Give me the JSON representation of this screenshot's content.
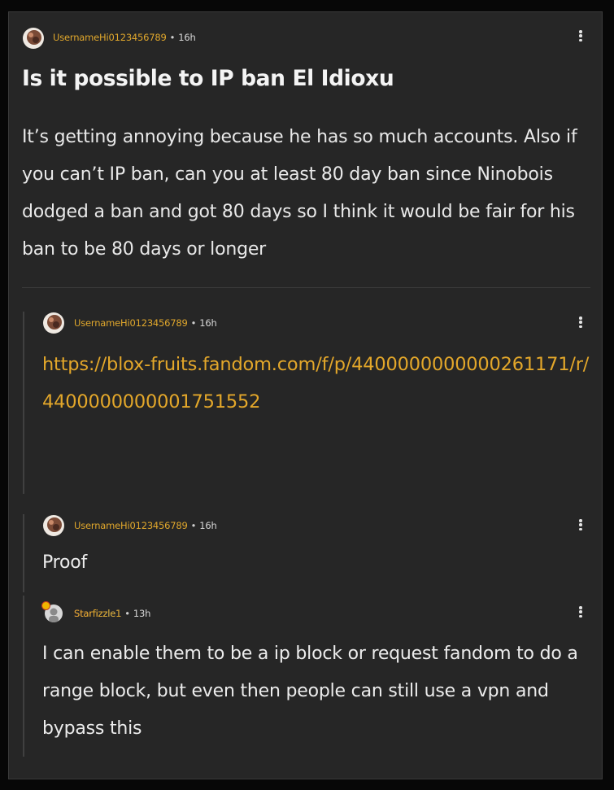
{
  "post": {
    "author": "UsernameHi0123456789",
    "time": "16h",
    "title": "Is it possible to IP ban El Idioxu",
    "body": "It’s getting annoying because he has so much accounts. Also if you can’t IP ban, can you at least 80 day ban since Ninobois dodged a ban and got 80 days so I think it would be fair for his ban to be 80 days or longer"
  },
  "replies": [
    {
      "author": "UsernameHi0123456789",
      "time": "16h",
      "text": "https://blox-fruits.fandom.com/f/p/4400000000000261171/r/4400000000001751552"
    },
    {
      "author": "UsernameHi0123456789",
      "time": "16h",
      "text": "Proof"
    },
    {
      "author": "Starfizzle1",
      "time": "13h",
      "text": "I can enable them to be a ip block or request fandom to do a range block, but even then people can still use a vpn and bypass this"
    }
  ],
  "separator": "•",
  "icons": {
    "more": "more-vertical-icon",
    "avatar": "user-avatar",
    "badge": "staff-badge-icon"
  },
  "colors": {
    "background": "#262626",
    "username": "#e0a72c",
    "link": "#e3a72a",
    "text": "#e9e9e9"
  }
}
